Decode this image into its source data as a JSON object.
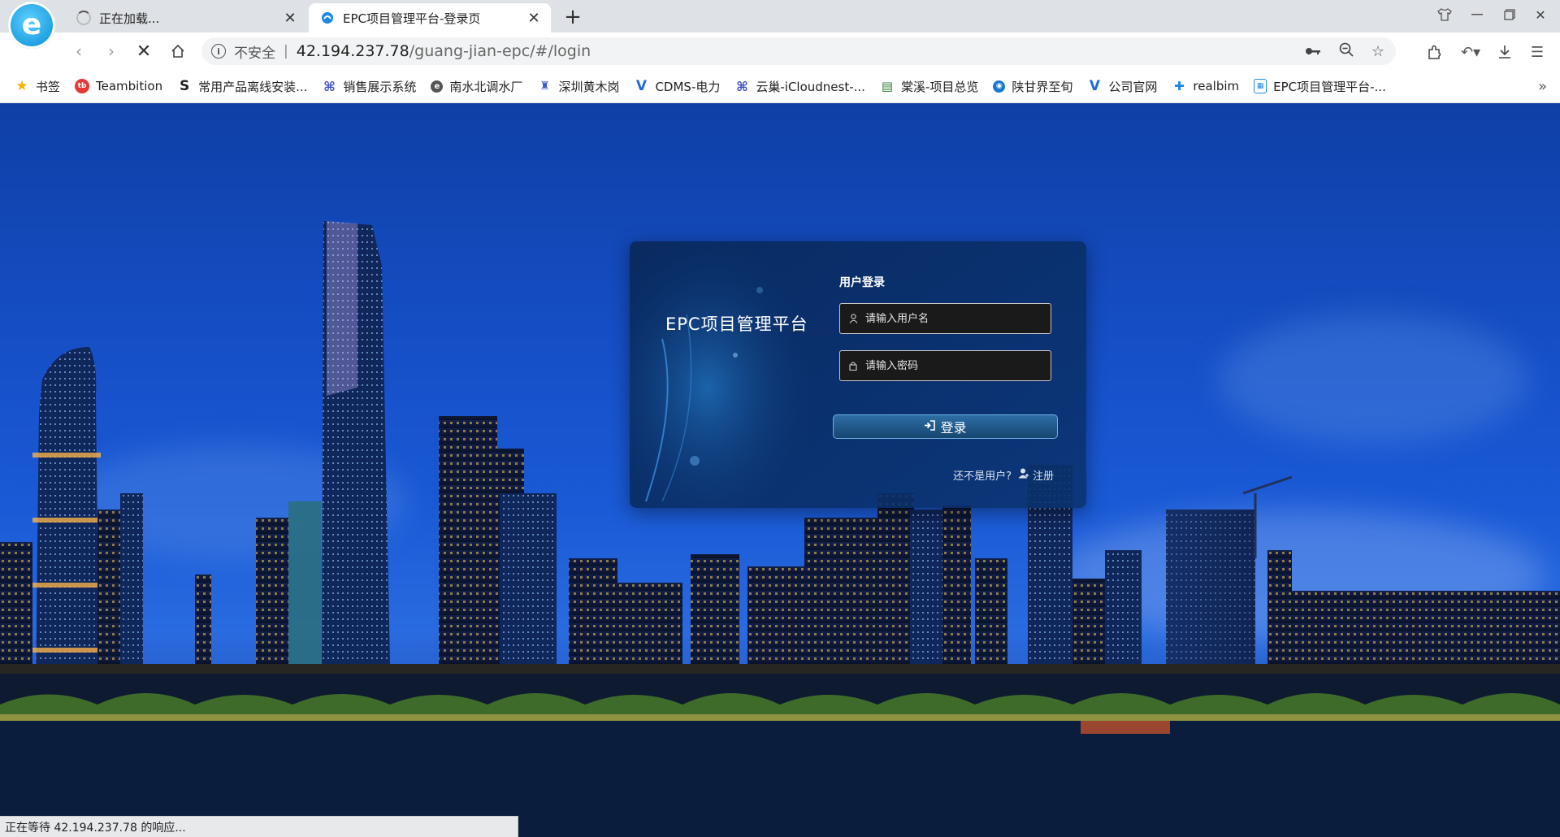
{
  "browser": {
    "tabs": [
      {
        "title": "正在加载...",
        "state": "loading"
      },
      {
        "title": "EPC项目管理平台-登录页",
        "state": "active"
      }
    ],
    "new_tab_label": "+",
    "address": {
      "security_label": "不安全",
      "separator": "|",
      "host": "42.194.237.78",
      "path": "/guang-jian-epc/#/login"
    },
    "bookmarks": [
      {
        "label": "书签",
        "icon": "star-icon",
        "color": "#f5b400"
      },
      {
        "label": "Teambition",
        "icon": "teambition-icon",
        "color": "#e53935"
      },
      {
        "label": "常用产品离线安装...",
        "icon": "s-logo-icon",
        "color": "#333333"
      },
      {
        "label": "销售展示系统",
        "icon": "grid-icon",
        "color": "#3b4cc0"
      },
      {
        "label": "南水北调水厂",
        "icon": "circle-e-icon",
        "color": "#555555"
      },
      {
        "label": "深圳黄木岗",
        "icon": "building-icon",
        "color": "#3b5bd0"
      },
      {
        "label": "CDMS-电力",
        "icon": "v-logo-icon",
        "color": "#1e6ad8"
      },
      {
        "label": "云巢-iCloudnest-...",
        "icon": "grid-icon",
        "color": "#3b4cc0"
      },
      {
        "label": "棠溪-项目总览",
        "icon": "doc-icon",
        "color": "#2e7d32"
      },
      {
        "label": "陕甘界至旬",
        "icon": "globe-icon",
        "color": "#1976d2"
      },
      {
        "label": "公司官网",
        "icon": "v-logo-icon",
        "color": "#1e6ad8"
      },
      {
        "label": "realbim",
        "icon": "realbim-icon",
        "color": "#1e88e5"
      },
      {
        "label": "EPC项目管理平台-...",
        "icon": "epc-icon",
        "color": "#1e88e5"
      }
    ],
    "bookmarks_more": "»",
    "status_text": "正在等待 42.194.237.78 的响应..."
  },
  "login": {
    "platform_title": "EPC项目管理平台",
    "form_heading": "用户登录",
    "username_placeholder": "请输入用户名",
    "password_placeholder": "请输入密码",
    "login_button": "登录",
    "register_prompt": "还不是用户?",
    "register_link": "注册"
  },
  "colors": {
    "accent": "#1a9de0",
    "card_bg": "#0a3270",
    "button_border": "#6fb0e0"
  }
}
